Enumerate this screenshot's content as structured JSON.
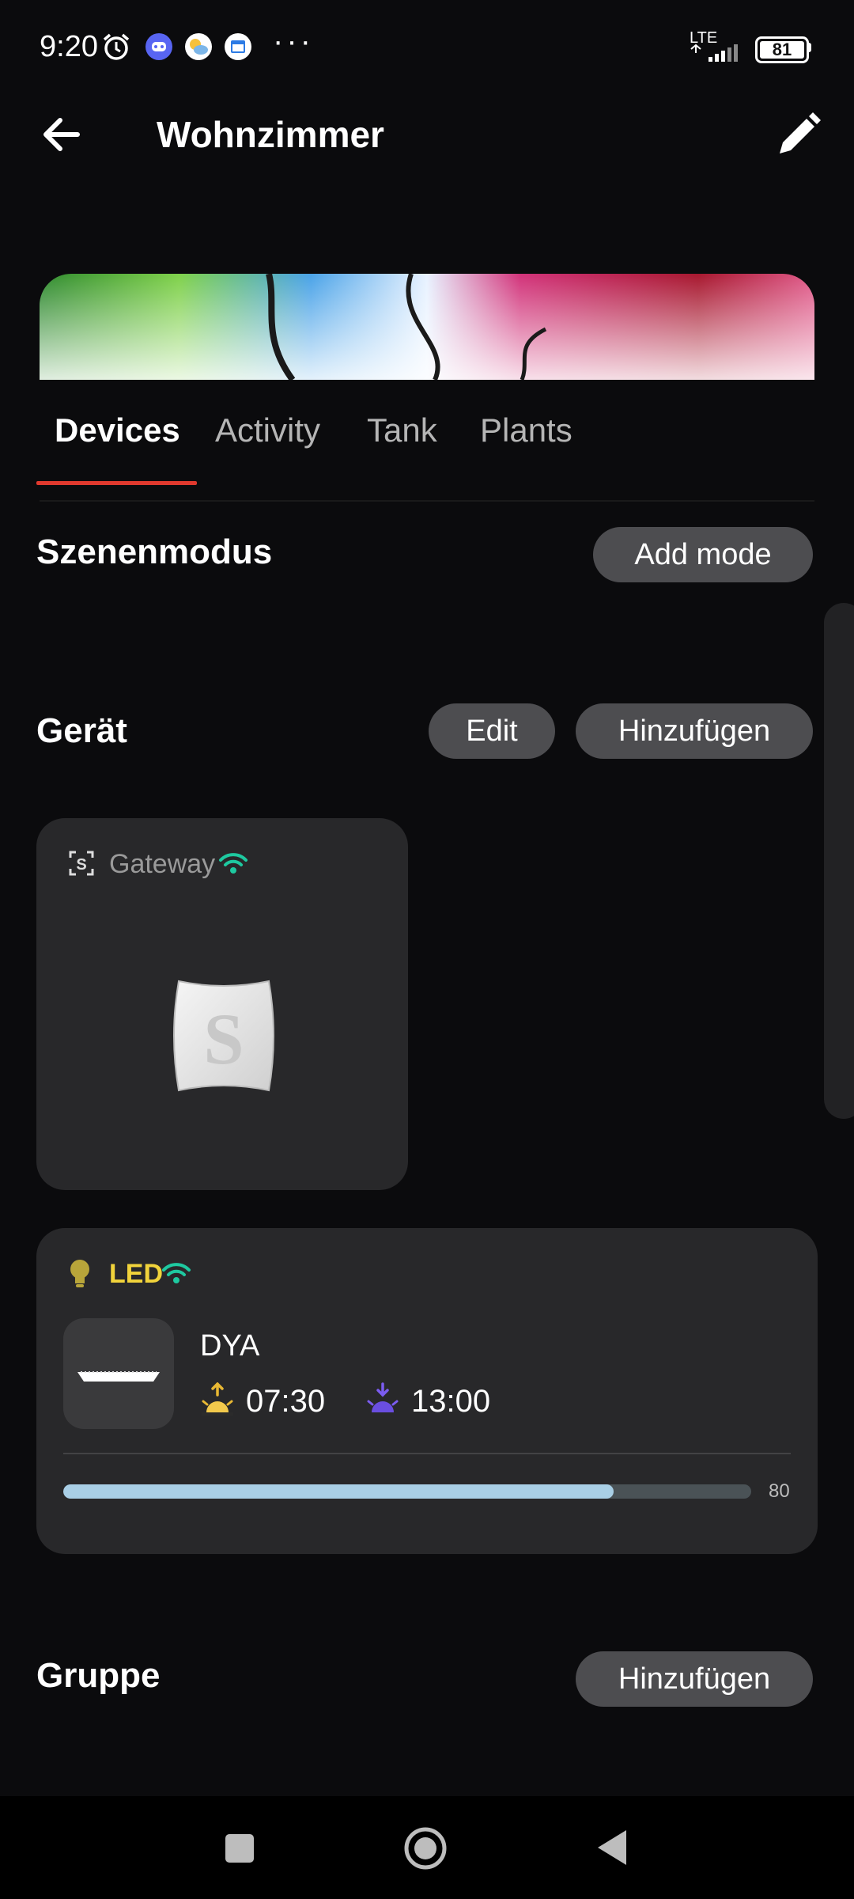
{
  "status_bar": {
    "time": "9:20",
    "network": "LTE",
    "battery": "81",
    "more": "···",
    "icons": [
      "alarm-icon",
      "discord-icon",
      "weather-icon",
      "calendar-icon",
      "signal-icon",
      "battery-icon"
    ]
  },
  "header": {
    "title": "Wohnzimmer",
    "back_icon": "arrow-left-icon",
    "edit_icon": "pencil-icon"
  },
  "tabs": [
    {
      "label": "Devices",
      "active": true
    },
    {
      "label": "Activity",
      "active": false
    },
    {
      "label": "Tank",
      "active": false
    },
    {
      "label": "Plants",
      "active": false
    }
  ],
  "scene_section": {
    "title": "Szenenmodus",
    "add_button": "Add mode"
  },
  "device_section": {
    "title": "Gerät",
    "edit_button": "Edit",
    "add_button": "Hinzufügen"
  },
  "gateway_card": {
    "label": "Gateway",
    "status_icon": "wifi-icon"
  },
  "led_card": {
    "label": "LED",
    "status_icon": "wifi-icon",
    "device_name": "DYA",
    "sunrise_time": "07:30",
    "sunset_time": "13:00",
    "brightness": 80,
    "brightness_label": "80"
  },
  "group_section": {
    "title": "Gruppe",
    "add_button": "Hinzufügen"
  },
  "nav_bar": {
    "icons": [
      "recents-square-icon",
      "home-circle-icon",
      "back-triangle-icon"
    ]
  },
  "colors": {
    "background": "#0b0b0d",
    "card": "#28282a",
    "pill": "#4d4d50",
    "accent_tab": "#e0392e",
    "wifi": "#1ec9a0",
    "led_label": "#f1d33b",
    "progress": "#a9cfe6"
  }
}
